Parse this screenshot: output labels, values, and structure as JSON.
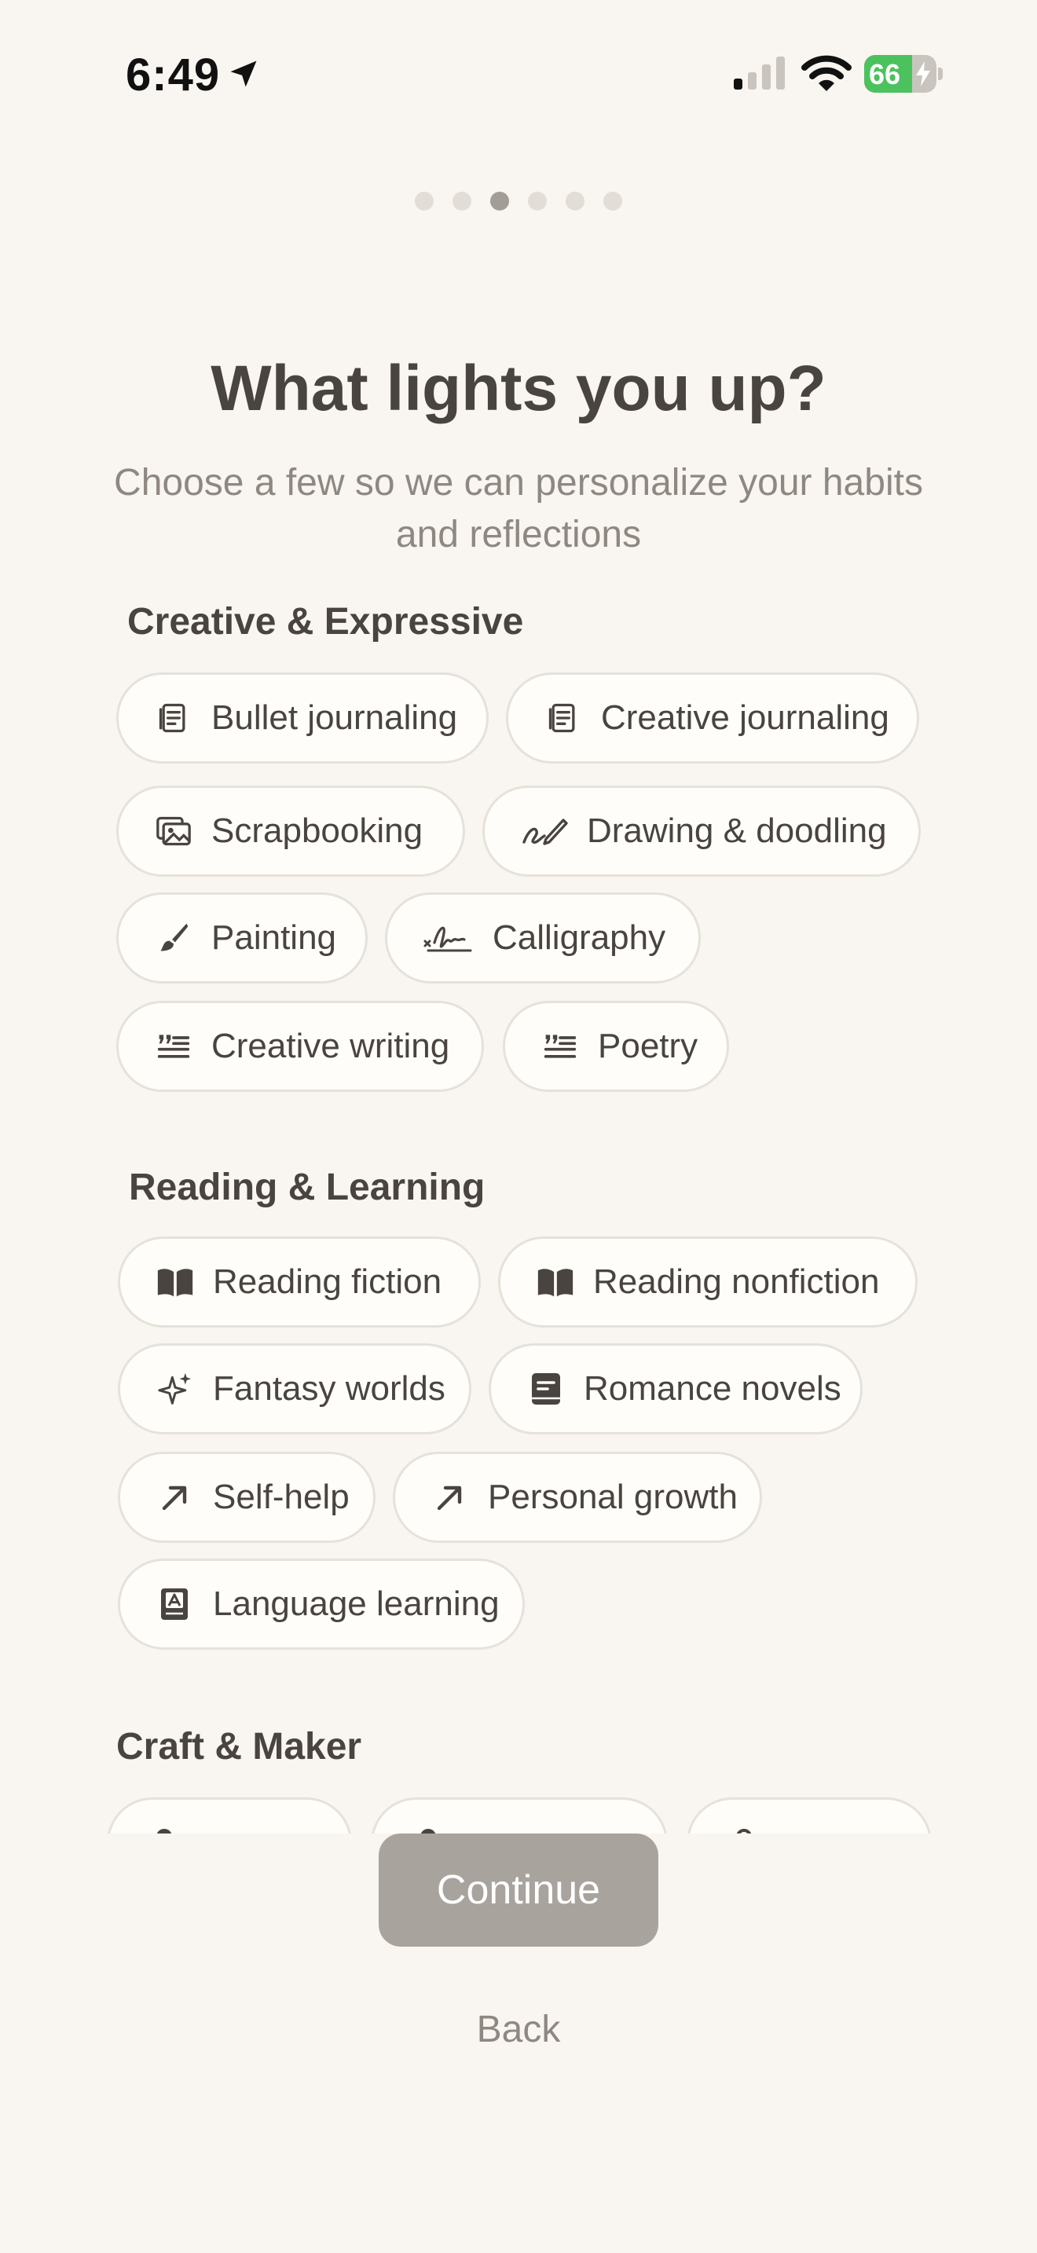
{
  "status_bar": {
    "time": "6:49",
    "battery_level": "66",
    "battery_fraction": 0.66
  },
  "pager": {
    "total": 6,
    "active": 3
  },
  "header": {
    "title": "What lights you up?",
    "subtitle": "Choose a few so we can personalize your habits and reflections"
  },
  "sections": [
    {
      "title": "Creative & Expressive",
      "chips": [
        {
          "label": "Bullet journaling",
          "icon": "journal-icon"
        },
        {
          "label": "Creative journaling",
          "icon": "journal-icon"
        },
        {
          "label": "Scrapbooking",
          "icon": "photos-icon"
        },
        {
          "label": "Drawing & doodling",
          "icon": "pencil-scribble-icon"
        },
        {
          "label": "Painting",
          "icon": "paintbrush-icon"
        },
        {
          "label": "Calligraphy",
          "icon": "signature-icon"
        },
        {
          "label": "Creative writing",
          "icon": "quote-text-icon"
        },
        {
          "label": "Poetry",
          "icon": "quote-text-icon"
        }
      ]
    },
    {
      "title": "Reading & Learning",
      "chips": [
        {
          "label": "Reading fiction",
          "icon": "open-book-icon"
        },
        {
          "label": "Reading nonfiction",
          "icon": "open-book-icon"
        },
        {
          "label": "Fantasy worlds",
          "icon": "sparkles-icon"
        },
        {
          "label": "Romance novels",
          "icon": "book-cover-icon"
        },
        {
          "label": "Self-help",
          "icon": "arrow-up-right-icon"
        },
        {
          "label": "Personal growth",
          "icon": "arrow-up-right-icon"
        },
        {
          "label": "Language learning",
          "icon": "dictionary-icon"
        }
      ]
    },
    {
      "title": "Craft & Maker",
      "chips": []
    }
  ],
  "footer": {
    "continue_label": "Continue",
    "back_label": "Back"
  },
  "colors": {
    "background": "#f9f5f0",
    "chip_bg": "#fffdf9",
    "chip_border": "#e6e1db",
    "text": "#4a4440",
    "muted": "#8f8882",
    "continue_disabled": "#a8a39d",
    "battery_green": "#4cc25e"
  }
}
